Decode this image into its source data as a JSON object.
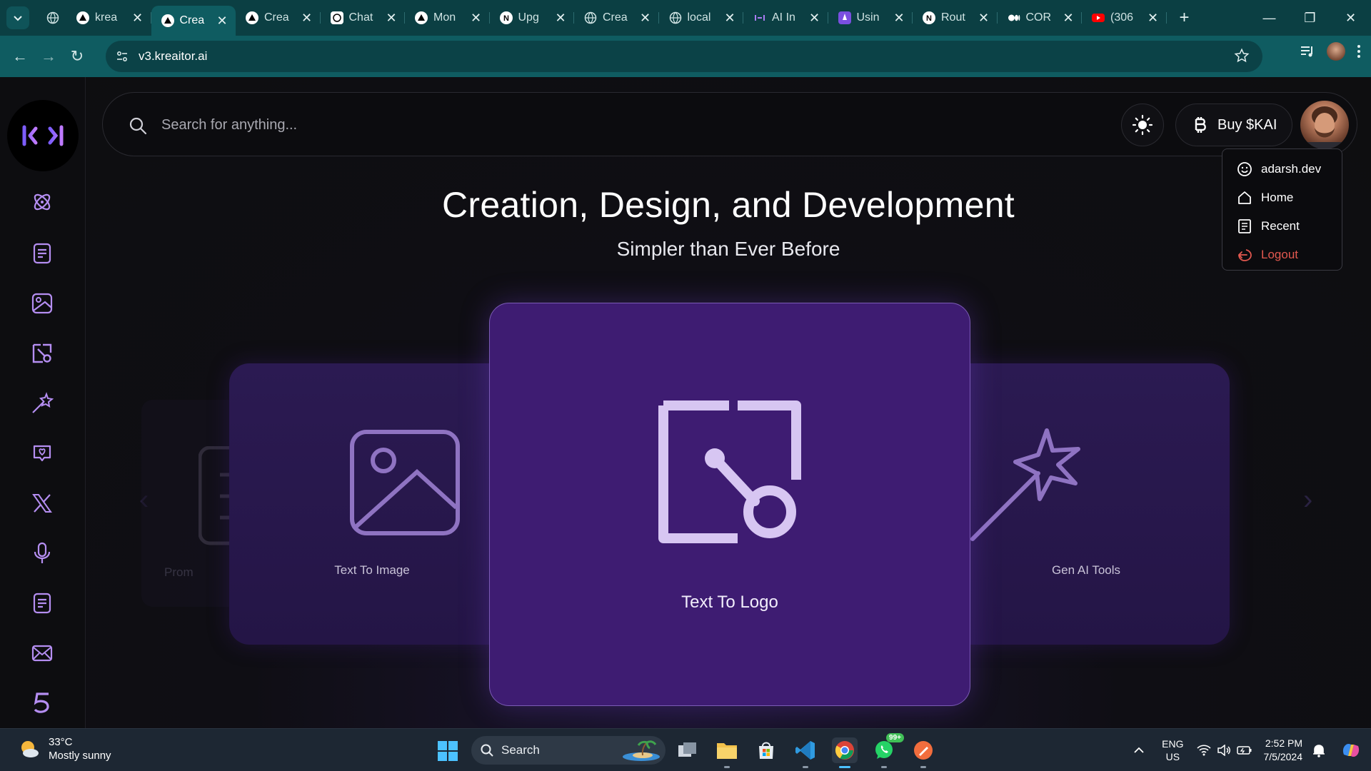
{
  "browser": {
    "tabs": [
      {
        "title": "",
        "icon": "globe-icon"
      },
      {
        "title": "krea",
        "icon": "triangle-logo-icon"
      },
      {
        "title": "Crea",
        "icon": "triangle-logo-icon",
        "active": true
      },
      {
        "title": "Crea",
        "icon": "triangle-logo-icon"
      },
      {
        "title": "Chat",
        "icon": "openai-icon"
      },
      {
        "title": "Mon",
        "icon": "triangle-logo-icon"
      },
      {
        "title": "Upg",
        "icon": "notion-icon"
      },
      {
        "title": "Crea",
        "icon": "globe-icon"
      },
      {
        "title": "local",
        "icon": "globe-icon"
      },
      {
        "title": "AI In",
        "icon": "kreaitor-icon"
      },
      {
        "title": "Usin",
        "icon": "rocket-icon"
      },
      {
        "title": "Rout",
        "icon": "notion-icon"
      },
      {
        "title": "COR",
        "icon": "medium-icon"
      },
      {
        "title": "(306",
        "icon": "youtube-icon"
      }
    ],
    "url": "v3.kreaitor.ai"
  },
  "header": {
    "search_placeholder": "Search for anything...",
    "buy_label": "Buy $KAI"
  },
  "hero": {
    "title": "Creation, Design, and Development",
    "subtitle": "Simpler than Ever Before"
  },
  "carousel": {
    "far_left_label": "Prom",
    "left_label": "Text To Image",
    "center_label": "Text To Logo",
    "right_label": "Gen AI Tools"
  },
  "profile_menu": {
    "items": [
      {
        "label": "adarsh.dev",
        "icon": "smiley-icon"
      },
      {
        "label": "Home",
        "icon": "home-icon"
      },
      {
        "label": "Recent",
        "icon": "document-icon"
      },
      {
        "label": "Logout",
        "icon": "logout-icon"
      }
    ]
  },
  "taskbar": {
    "weather_temp": "33°C",
    "weather_desc": "Mostly sunny",
    "search_label": "Search",
    "whatsapp_badge": "99+",
    "lang_top": "ENG",
    "lang_bottom": "US",
    "time": "2:52 PM",
    "date": "7/5/2024"
  },
  "colors": {
    "accent_purple": "#3e1c72",
    "sidebar_icon": "#b58ef2",
    "logout_red": "#e2584f",
    "chrome_teal": "#0f5c61"
  }
}
